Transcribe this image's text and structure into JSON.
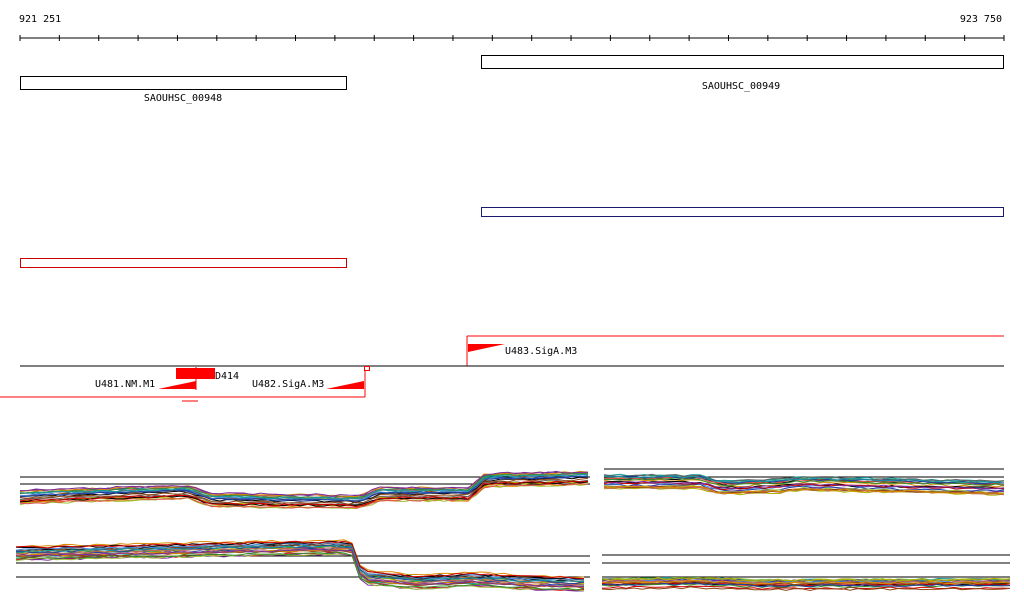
{
  "coords": {
    "start": "921 251",
    "end": "923 750"
  },
  "genes": [
    {
      "id": "SAOUHSC_00948",
      "strand": "-",
      "start": 921251,
      "end": 921918
    },
    {
      "id": "SAOUHSC_00949",
      "strand": "+",
      "start": 922194,
      "end": 923750
    }
  ],
  "annotations": {
    "u481": "U481.NM.M1",
    "u482": "U482.SigA.M3",
    "u483": "U483.SigA.M3",
    "d414": "D414"
  },
  "colors": {
    "axis": "#000000",
    "plus_strand_box": "#1a1a6e",
    "minus_strand_box": "#cc0000",
    "feature": "#ff0000",
    "tracks": [
      "#000000",
      "#cc0000",
      "#2f8f2f",
      "#1f3fa0",
      "#8b4513",
      "#d98c00",
      "#7b2a9a",
      "#1c9aa0",
      "#9fbf3b",
      "#e05050",
      "#606060",
      "#b0b000",
      "#4a90e2",
      "#c06060"
    ]
  }
}
